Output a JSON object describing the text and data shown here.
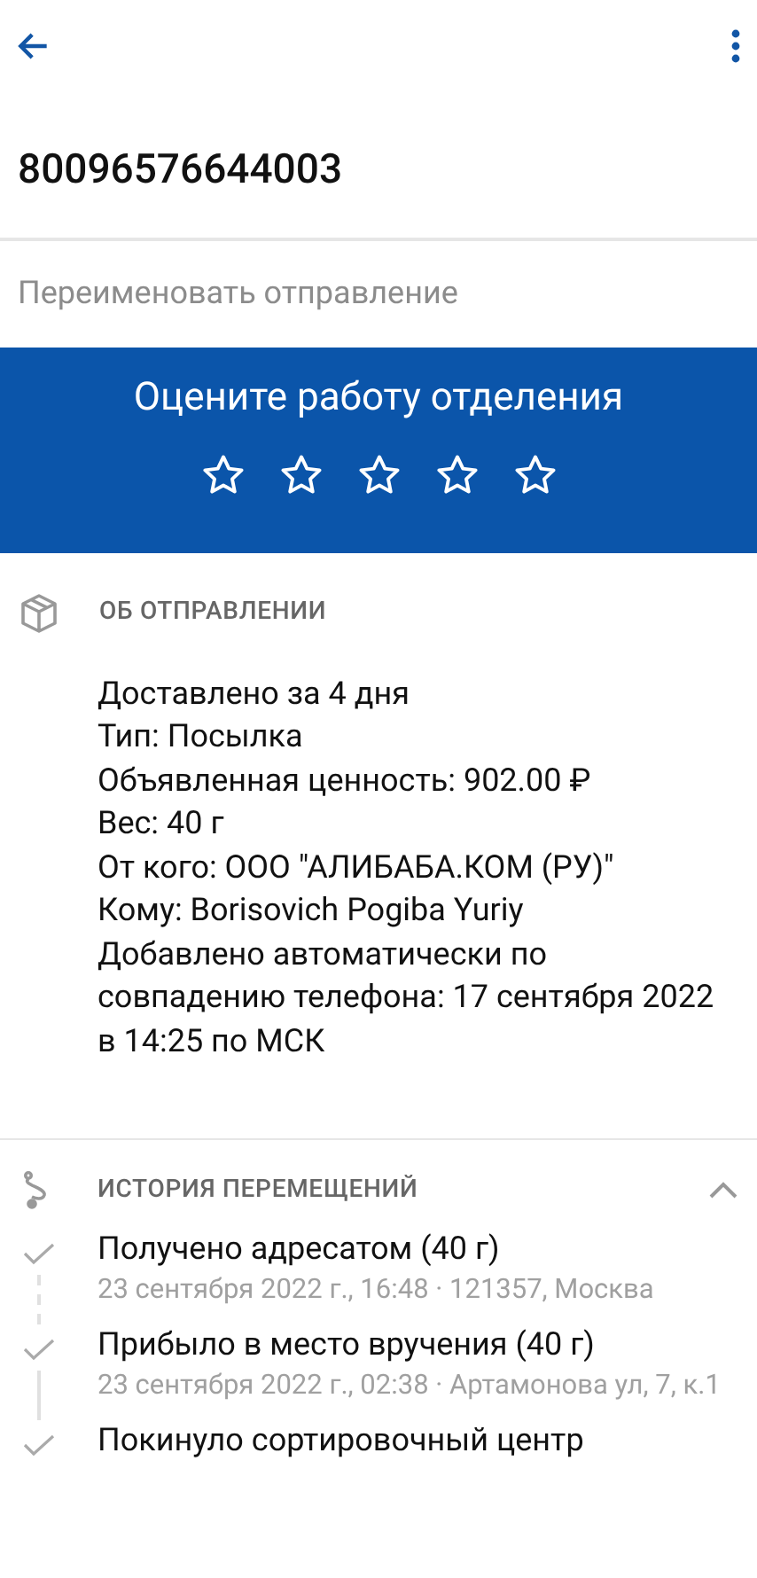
{
  "tracking_number": "80096576644003",
  "rename_field": {
    "placeholder": "Переименовать отправление"
  },
  "rating": {
    "title": "Оцените работу отделения",
    "stars": 0
  },
  "about": {
    "title": "ОБ ОТПРАВЛЕНИИ",
    "lines": [
      "Доставлено за 4 дня",
      "Тип: Посылка",
      "Объявленная ценность: 902.00 ₽",
      "Вес: 40 г",
      "От кого: ООО \"АЛИБАБА.КОМ (РУ)\"",
      "Кому: Borisovich Pogiba Yuriy",
      "Добавлено автоматически по совпадению телефона: 17 сентября 2022 в 14:25 по МСК"
    ]
  },
  "history": {
    "title": "ИСТОРИЯ ПЕРЕМЕЩЕНИЙ",
    "expanded": true,
    "events": [
      {
        "title": "Получено адресатом (40 г)",
        "detail": "23 сентября 2022 г., 16:48 · 121357, Москва"
      },
      {
        "title": "Прибыло в место вручения (40 г)",
        "detail": "23 сентября 2022 г., 02:38 · Артамонова ул, 7, к.1"
      },
      {
        "title": "Покинуло сортировочный центр"
      }
    ]
  }
}
